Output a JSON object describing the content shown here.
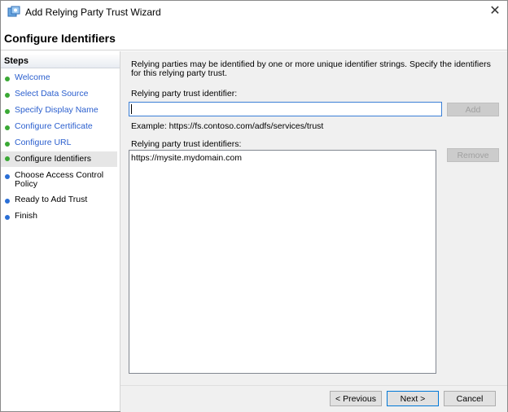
{
  "window": {
    "title": "Add Relying Party Trust Wizard",
    "close_glyph": "✕"
  },
  "header": {
    "page_title": "Configure Identifiers"
  },
  "sidebar": {
    "heading": "Steps",
    "items": [
      {
        "label": "Welcome",
        "state": "done"
      },
      {
        "label": "Select Data Source",
        "state": "done"
      },
      {
        "label": "Specify Display Name",
        "state": "done"
      },
      {
        "label": "Configure Certificate",
        "state": "done"
      },
      {
        "label": "Configure URL",
        "state": "done"
      },
      {
        "label": "Configure Identifiers",
        "state": "current"
      },
      {
        "label": "Choose Access Control Policy",
        "state": "pending"
      },
      {
        "label": "Ready to Add Trust",
        "state": "pending"
      },
      {
        "label": "Finish",
        "state": "pending"
      }
    ]
  },
  "main": {
    "description": "Relying parties may be identified by one or more unique identifier strings. Specify the identifiers for this relying party trust.",
    "identifier_label": "Relying party trust identifier:",
    "identifier_value": "",
    "add_label": "Add",
    "example": "Example: https://fs.contoso.com/adfs/services/trust",
    "identifiers_label": "Relying party trust identifiers:",
    "identifiers": [
      "https://mysite.mydomain.com"
    ],
    "remove_label": "Remove"
  },
  "footer": {
    "previous": "< Previous",
    "next": "Next >",
    "cancel": "Cancel"
  },
  "colors": {
    "done": "#3aa935",
    "pending": "#2a6fd6",
    "link": "#2b5fce",
    "accent": "#0078d7"
  }
}
